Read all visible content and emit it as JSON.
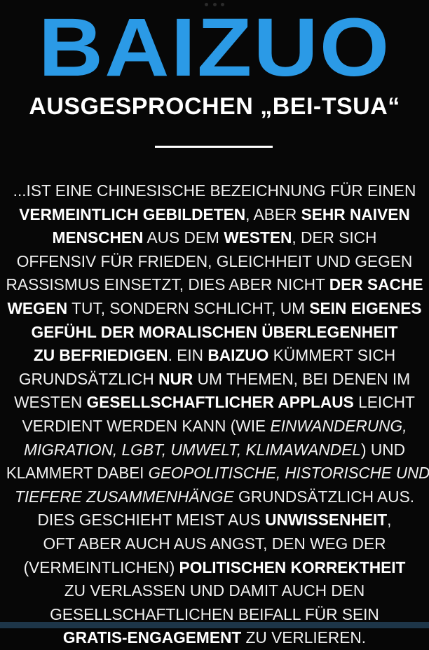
{
  "poster": {
    "title": "BAIZUO",
    "subtitle": "AUSGESPROCHEN „BEI-TSUA“",
    "title_color": "#2b9ae6",
    "background_color": "#070707",
    "text_color": "#ffffff",
    "bottom_bar_color": "#1d3548"
  },
  "body": {
    "lines": [
      [
        {
          "t": "...IST EINE CHINESISCHE BEZEICHNUNG FÜR EINEN",
          "s": "n"
        }
      ],
      [
        {
          "t": "VERMEINTLICH GEBILDETEN",
          "s": "b"
        },
        {
          "t": ", ABER ",
          "s": "n"
        },
        {
          "t": "SEHR NAIVEN",
          "s": "b"
        }
      ],
      [
        {
          "t": "MENSCHEN",
          "s": "b"
        },
        {
          "t": " AUS DEM ",
          "s": "n"
        },
        {
          "t": "WESTEN",
          "s": "b"
        },
        {
          "t": ", DER SICH",
          "s": "n"
        }
      ],
      [
        {
          "t": "OFFENSIV FÜR FRIEDEN, GLEICHHEIT UND GEGEN",
          "s": "n"
        }
      ],
      [
        {
          "t": "RASSISMUS EINSETZT, DIES ABER NICHT ",
          "s": "n"
        },
        {
          "t": "DER SACHE",
          "s": "b"
        }
      ],
      [
        {
          "t": "WEGEN",
          "s": "b"
        },
        {
          "t": " TUT, SONDERN SCHLICHT, UM ",
          "s": "n"
        },
        {
          "t": "SEIN EIGENES",
          "s": "b"
        }
      ],
      [
        {
          "t": "GEFÜHL DER MORALISCHEN ÜBERLEGENHEIT",
          "s": "b"
        }
      ],
      [
        {
          "t": "ZU BEFRIEDIGEN",
          "s": "b"
        },
        {
          "t": ". EIN ",
          "s": "n"
        },
        {
          "t": "BAIZUO",
          "s": "b"
        },
        {
          "t": " KÜMMERT SICH",
          "s": "n"
        }
      ],
      [
        {
          "t": "GRUNDSÄTZLICH ",
          "s": "n"
        },
        {
          "t": "NUR",
          "s": "b"
        },
        {
          "t": " UM THEMEN, BEI DENEN IM",
          "s": "n"
        }
      ],
      [
        {
          "t": "WESTEN ",
          "s": "n"
        },
        {
          "t": "GESELLSCHAFTLICHER APPLAUS",
          "s": "b"
        },
        {
          "t": " LEICHT",
          "s": "n"
        }
      ],
      [
        {
          "t": "VERDIENT WERDEN KANN (WIE ",
          "s": "n"
        },
        {
          "t": "EINWANDERUNG,",
          "s": "i"
        }
      ],
      [
        {
          "t": "MIGRATION, LGBT, UMWELT, KLIMAWANDEL",
          "s": "i"
        },
        {
          "t": ") UND",
          "s": "n"
        }
      ],
      [
        {
          "t": "KLAMMERT DABEI ",
          "s": "n"
        },
        {
          "t": "GEOPOLITISCHE, HISTORISCHE UND",
          "s": "i"
        }
      ],
      [
        {
          "t": "TIEFERE ZUSAMMENHÄNGE",
          "s": "i"
        },
        {
          "t": " GRUNDSÄTZLICH AUS.",
          "s": "n"
        }
      ],
      [
        {
          "t": "DIES GESCHIEHT MEIST AUS ",
          "s": "n"
        },
        {
          "t": "UNWISSENHEIT",
          "s": "b"
        },
        {
          "t": ",",
          "s": "n"
        }
      ],
      [
        {
          "t": "OFT ABER AUCH AUS ANGST, DEN WEG DER",
          "s": "n"
        }
      ],
      [
        {
          "t": "(VERMEINTLICHEN) ",
          "s": "n"
        },
        {
          "t": "POLITISCHEN KORREKTHEIT",
          "s": "b"
        }
      ],
      [
        {
          "t": "ZU VERLASSEN UND DAMIT AUCH DEN",
          "s": "n"
        }
      ],
      [
        {
          "t": "GESELLSCHAFTLICHEN BEIFALL FÜR SEIN",
          "s": "n"
        }
      ],
      [
        {
          "t": "GRATIS-ENGAGEMENT",
          "s": "b"
        },
        {
          "t": " ZU VERLIEREN.",
          "s": "n"
        }
      ]
    ]
  }
}
